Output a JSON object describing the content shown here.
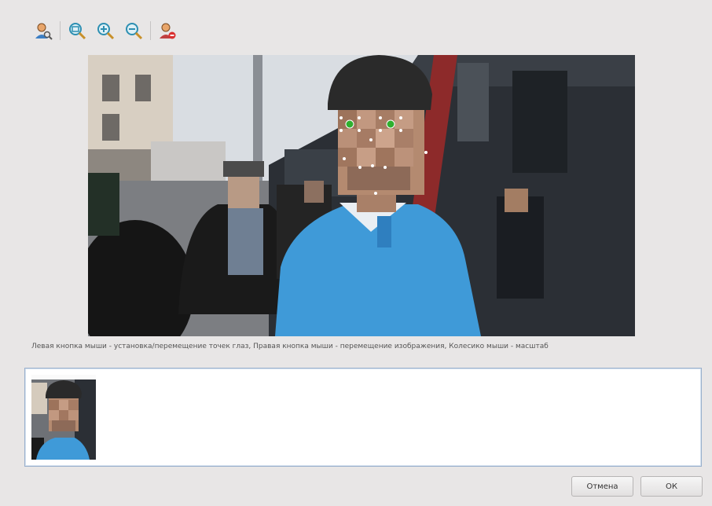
{
  "toolbar": {
    "buttons": [
      {
        "icon": "user-search-icon"
      },
      {
        "icon": "zoom-fit-icon"
      },
      {
        "icon": "zoom-in-icon"
      },
      {
        "icon": "zoom-out-icon"
      },
      {
        "icon": "user-remove-icon"
      }
    ]
  },
  "hint": {
    "text": "Левая кнопка мыши - установка/перемещение точек глаз, Правая кнопка мыши - перемещение изображения, Колесико мыши - масштаб"
  },
  "buttons": {
    "cancel_label": "Отмена",
    "ok_label": "ОК"
  },
  "colors": {
    "accent": "#2fb02f",
    "shirt": "#3f9ad8",
    "panel_border": "#9ab0cc"
  }
}
